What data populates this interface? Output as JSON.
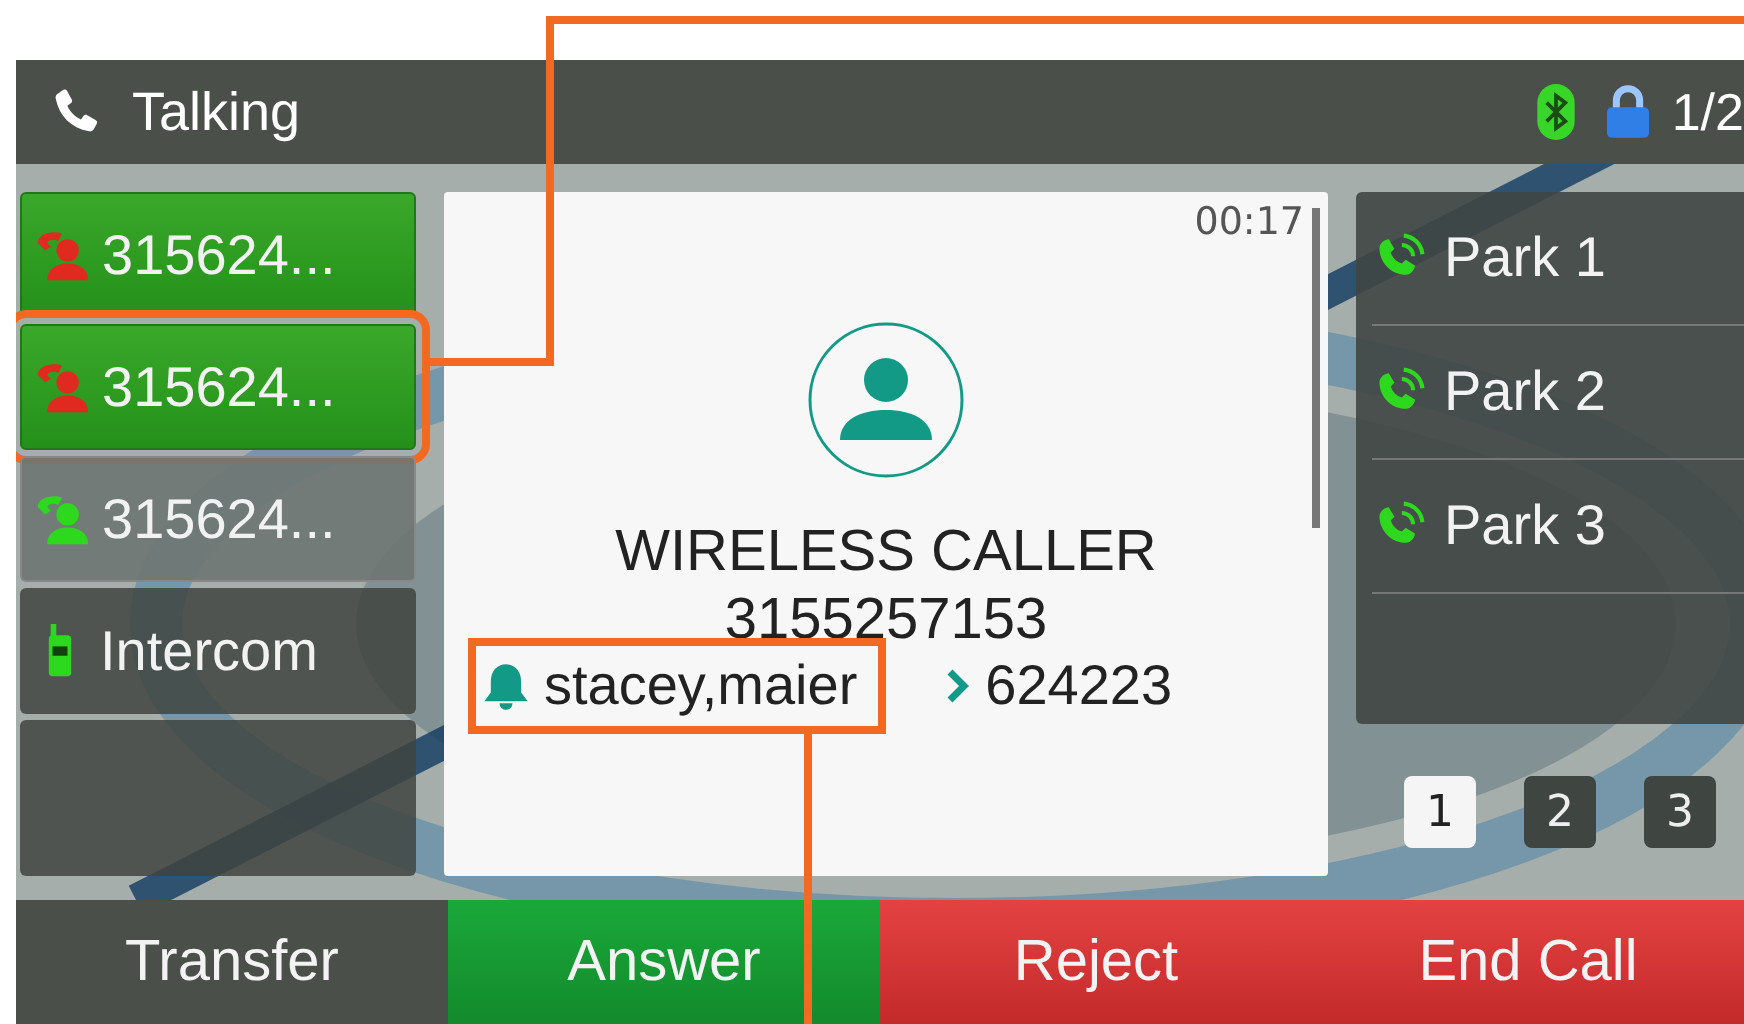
{
  "status_bar": {
    "title": "Talking",
    "bluetooth": true,
    "locked": true,
    "page": "1/2"
  },
  "lines": [
    {
      "kind": "call",
      "label": "315624...",
      "active": true,
      "color": "#e02a20",
      "highlighted": false
    },
    {
      "kind": "call",
      "label": "315624...",
      "active": true,
      "color": "#e02a20",
      "highlighted": true
    },
    {
      "kind": "call",
      "label": "315624...",
      "active": false,
      "color": "#2ed81e",
      "highlighted": false
    },
    {
      "kind": "intercom",
      "label": "Intercom",
      "active": false,
      "color": "#2ed81e",
      "highlighted": false
    }
  ],
  "call": {
    "timer": "00:17",
    "name": "WIRELESS CALLER",
    "number": "3155257153",
    "contact": "stacey,maier",
    "contact_highlighted": true,
    "forward_to": "624223"
  },
  "park_keys": [
    {
      "label": "Park 1"
    },
    {
      "label": "Park 2"
    },
    {
      "label": "Park 3"
    }
  ],
  "pages": [
    {
      "label": "1",
      "selected": true
    },
    {
      "label": "2",
      "selected": false
    },
    {
      "label": "3",
      "selected": false
    }
  ],
  "softkeys": [
    {
      "label": "Transfer",
      "kind": "neutral"
    },
    {
      "label": "Answer",
      "kind": "accept"
    },
    {
      "label": "Reject",
      "kind": "decline"
    },
    {
      "label": "End Call",
      "kind": "decline"
    }
  ]
}
